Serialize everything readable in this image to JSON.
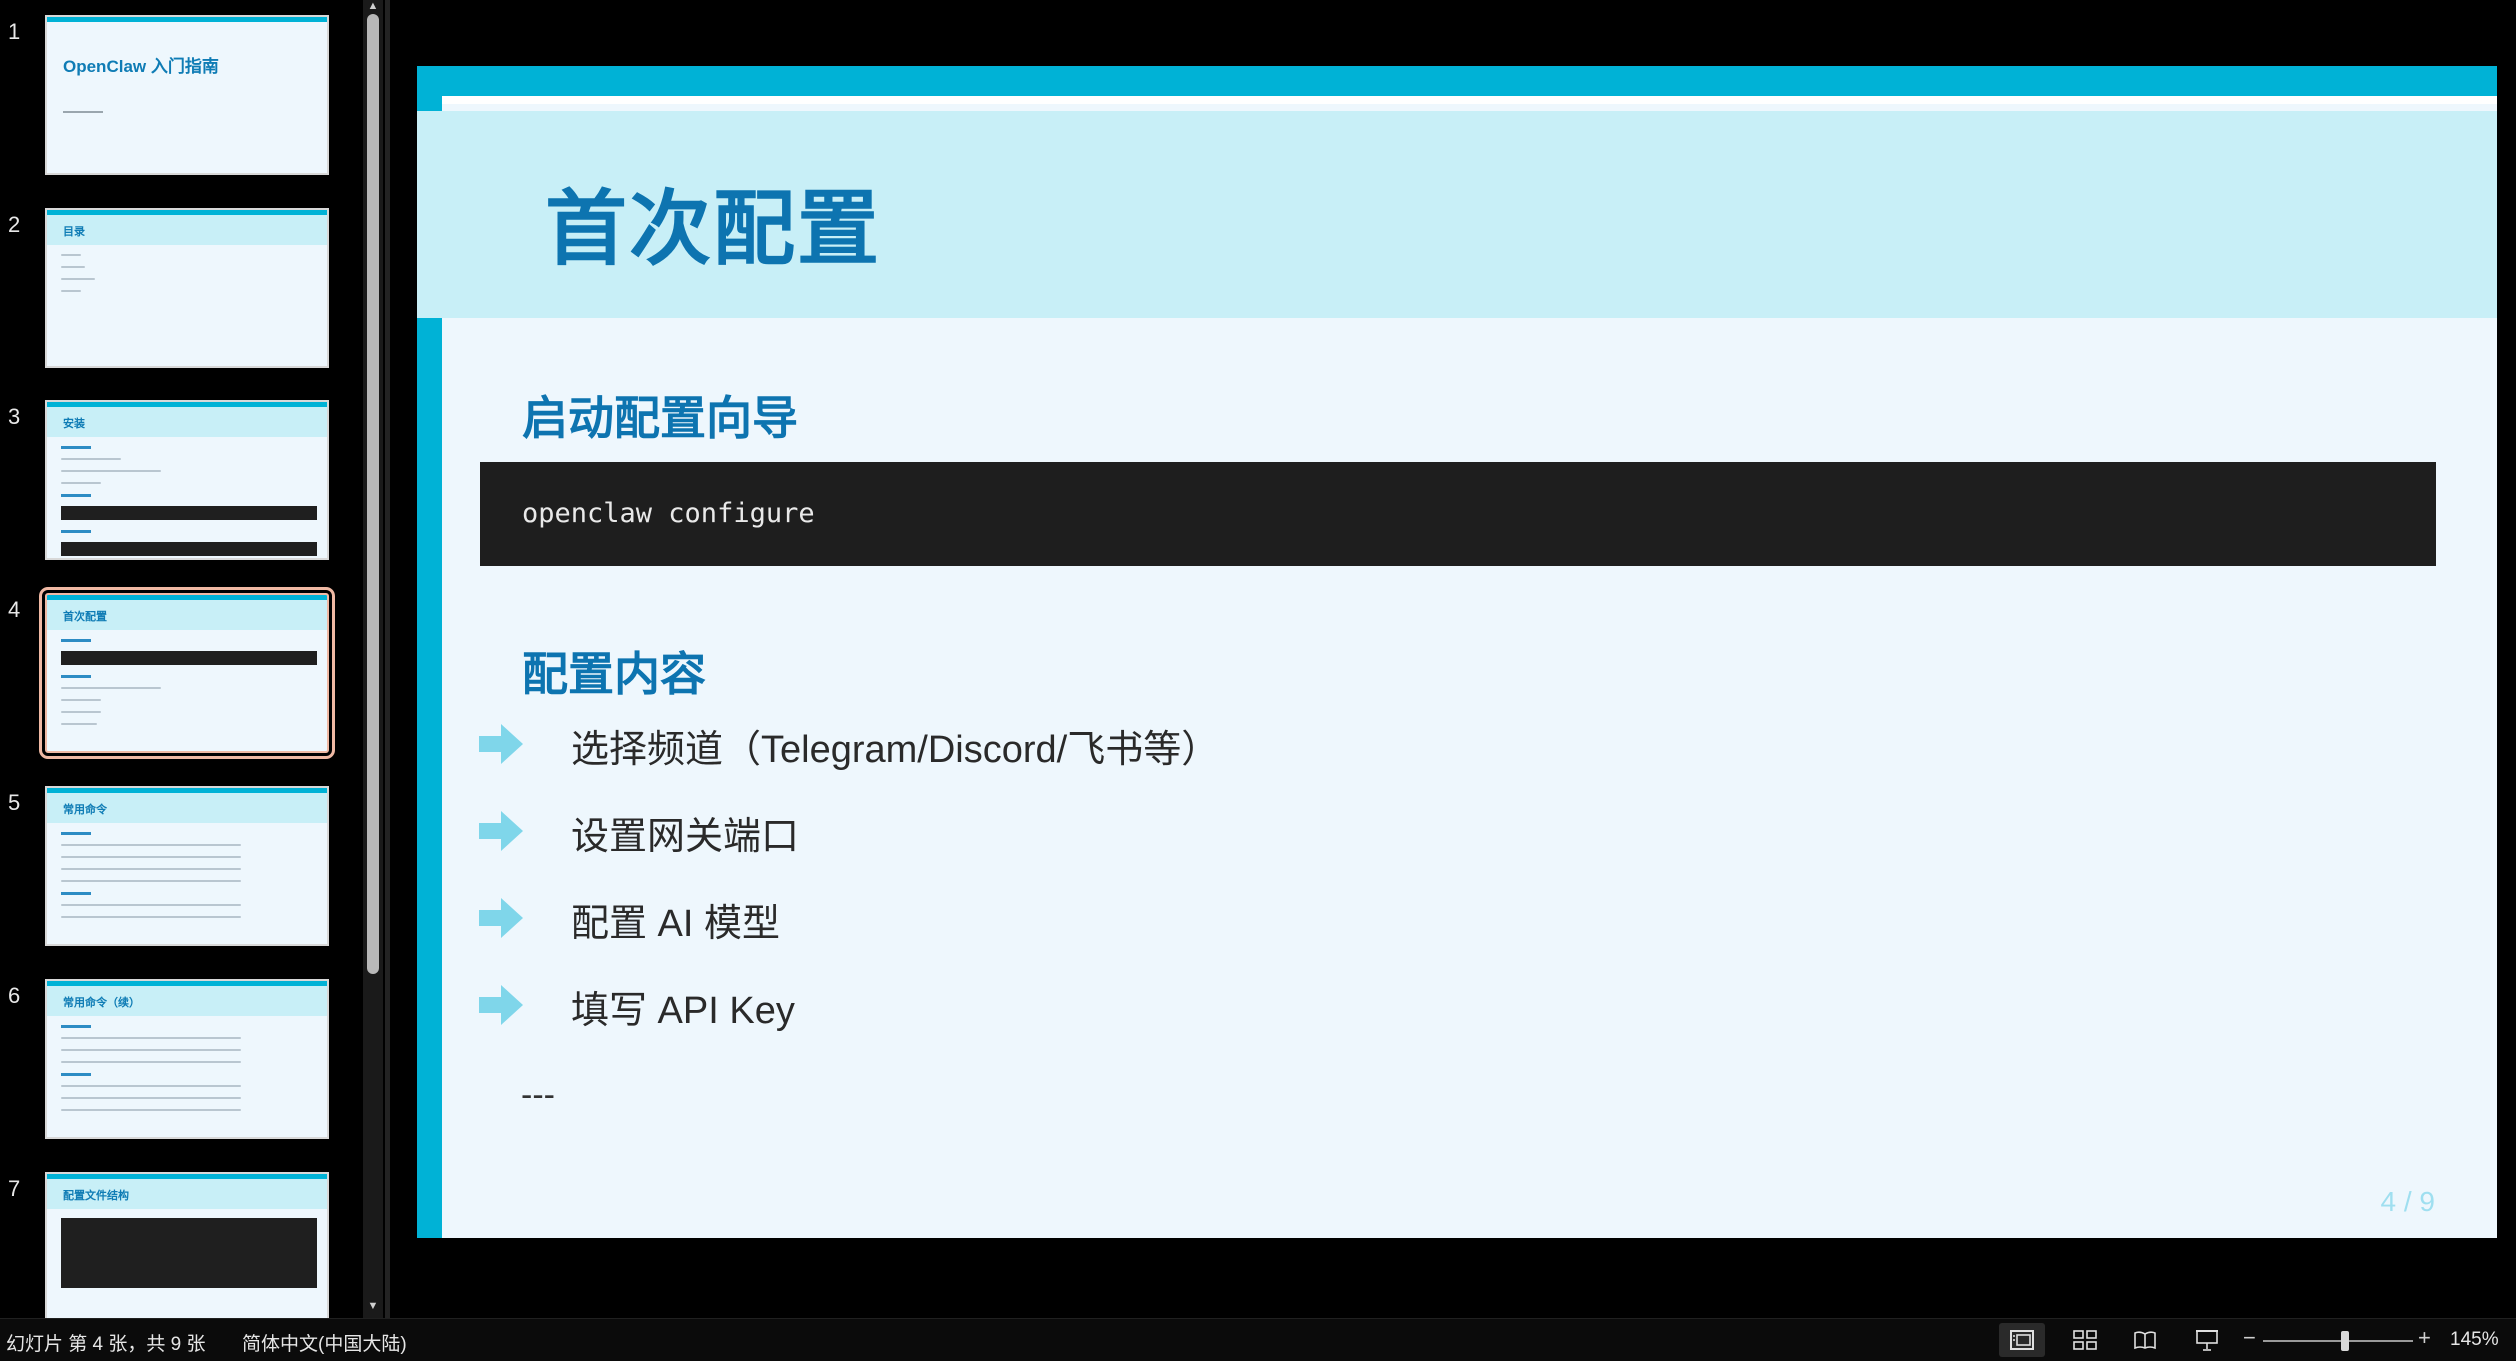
{
  "thumbnails": [
    {
      "number": "1",
      "title": "OpenClaw 入门指南"
    },
    {
      "number": "2",
      "title": "目录"
    },
    {
      "number": "3",
      "title": "安装"
    },
    {
      "number": "4",
      "title": "首次配置"
    },
    {
      "number": "5",
      "title": "常用命令"
    },
    {
      "number": "6",
      "title": "常用命令（续）"
    },
    {
      "number": "7",
      "title": "配置文件结构"
    }
  ],
  "selected_thumbnail": "4",
  "slide": {
    "title": "首次配置",
    "section1_heading": "启动配置向导",
    "code": "openclaw configure",
    "section2_heading": "配置内容",
    "bullets": [
      "选择频道（Telegram/Discord/飞书等）",
      "设置网关端口",
      "配置 AI 模型",
      "填写 API Key"
    ],
    "trailing_text": "---",
    "page_number": "4 / 9"
  },
  "status": {
    "slide_info": "幻灯片 第 4 张，共 9 张",
    "language": "简体中文(中国大陆)",
    "zoom": "145%",
    "zoom_minus": "−",
    "zoom_plus": "+"
  },
  "colors": {
    "accent_cyan": "#00b2d6",
    "title_blue": "#0d74b0",
    "band_light": "#c8eff7",
    "slide_bg": "#eef7fd",
    "bullet_arrow": "#7fd6ea"
  },
  "icons": {
    "view_normal": "normal-view-icon",
    "view_sorter": "slide-sorter-icon",
    "view_reading": "reading-view-icon",
    "view_slideshow": "slideshow-icon",
    "bullet": "arrow-right-icon"
  }
}
